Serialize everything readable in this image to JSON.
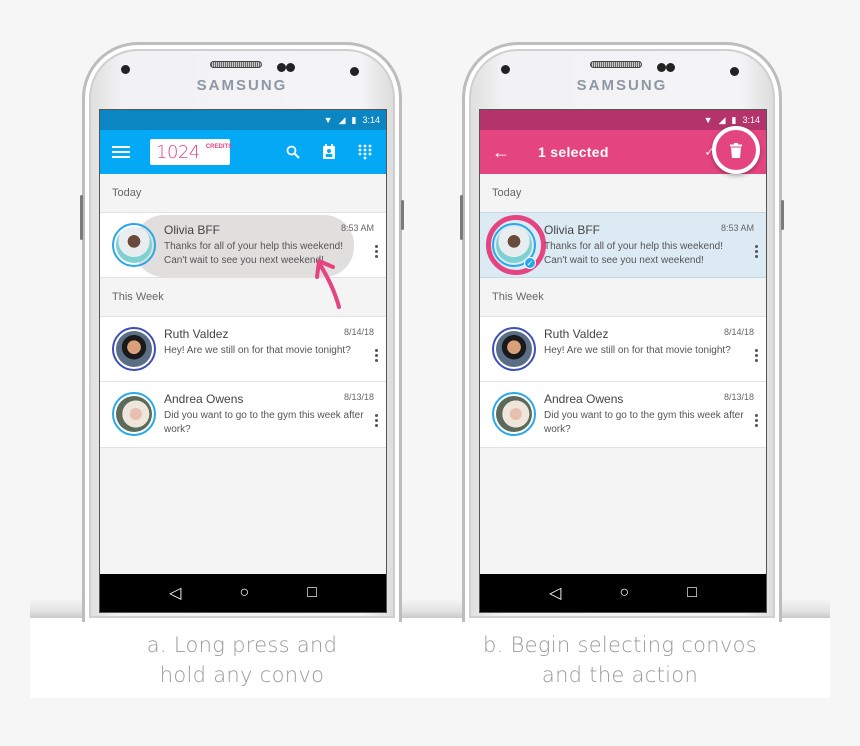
{
  "brand": "SAMSUNG",
  "status_time": "3:14",
  "colors": {
    "blue_status": "#0b86c2",
    "blue_appbar": "#03a9f4",
    "pink_status": "#b4336a",
    "pink_appbar": "#e4447f",
    "accent_pink": "#e4447f"
  },
  "left_phone": {
    "appbar": {
      "menu_icon": "hamburger-icon",
      "credits_value": "1024",
      "credits_label": "CREDITS",
      "actions": [
        "search-icon",
        "contact-icon",
        "dialpad-icon"
      ]
    },
    "sections": [
      {
        "header": "Today",
        "conversations": [
          {
            "name": "Olivia BFF",
            "time": "8:53 AM",
            "message": "Thanks for all of your help this weekend! Can't wait to see you next weekend!",
            "highlighted": true
          }
        ]
      },
      {
        "header": "This Week",
        "conversations": [
          {
            "name": "Ruth Valdez",
            "time": "8/14/18",
            "message": "Hey! Are we still on for that movie tonight?"
          },
          {
            "name": "Andrea Owens",
            "time": "8/13/18",
            "message": "Did you want to go to the gym this week after work?"
          }
        ]
      }
    ]
  },
  "right_phone": {
    "appbar": {
      "back_icon": "back-arrow-icon",
      "title": "1 selected",
      "actions": [
        "mark-read-icon",
        "trash-icon"
      ]
    },
    "sections": [
      {
        "header": "Today",
        "conversations": [
          {
            "name": "Olivia BFF",
            "time": "8:53 AM",
            "message": "Thanks for all of your help this weekend! Can't wait to see you next weekend!",
            "selected": true
          }
        ]
      },
      {
        "header": "This Week",
        "conversations": [
          {
            "name": "Ruth Valdez",
            "time": "8/14/18",
            "message": "Hey! Are we still on for that movie tonight?"
          },
          {
            "name": "Andrea Owens",
            "time": "8/13/18",
            "message": "Did you want to go to the gym this week after work?"
          }
        ]
      }
    ]
  },
  "nav": {
    "back": "◁",
    "home": "○",
    "recents": "□"
  },
  "captions": {
    "left": [
      "a. Long press and",
      "hold any convo"
    ],
    "right": [
      "b. Begin selecting convos",
      "and the action"
    ]
  }
}
